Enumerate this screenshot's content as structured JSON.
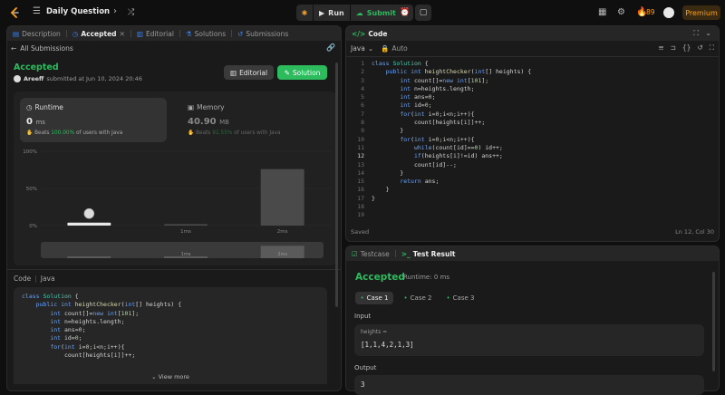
{
  "topbar": {
    "title": "Daily Question",
    "run_label": "Run",
    "submit_label": "Submit",
    "streak": "89",
    "premium_label": "Premium"
  },
  "left_tabs": {
    "description": "Description",
    "accepted": "Accepted",
    "editorial": "Editorial",
    "solutions": "Solutions",
    "submissions": "Submissions"
  },
  "submission": {
    "back_label": "All Submissions",
    "status": "Accepted",
    "author": "Areeff",
    "submitted_text": "submitted at Jun 10, 2024 20:46",
    "editorial_btn": "Editorial",
    "solution_btn": "Solution"
  },
  "runtime": {
    "label": "Runtime",
    "value": "0",
    "unit": "ms",
    "beats_prefix": "Beats",
    "beats_pct": "100.00%",
    "beats_suffix": "of users with Java"
  },
  "memory": {
    "label": "Memory",
    "value": "40.90",
    "unit": "MB",
    "beats_prefix": "Beats",
    "beats_pct": "91.55%",
    "beats_suffix": "of users with Java"
  },
  "chart_data": {
    "type": "bar",
    "ytick_labels": [
      "100%",
      "50%",
      "0%"
    ],
    "ylim": [
      0,
      100
    ],
    "categories": [
      "0ms",
      "1ms",
      "2ms"
    ],
    "values": [
      4,
      2,
      76
    ],
    "visible_x_labels": [
      "",
      "1ms",
      "2ms"
    ],
    "mini_labels": [
      "",
      "1ms",
      "2ms"
    ]
  },
  "lower_code": {
    "header": "Code",
    "lang": "Java",
    "view_more": "View more"
  },
  "editor": {
    "title": "Code",
    "lang": "Java",
    "auto": "Auto",
    "saved": "Saved",
    "cursor": "Ln 12, Col 30"
  },
  "testpanel": {
    "testcase_tab": "Testcase",
    "result_tab": "Test Result",
    "status": "Accepted",
    "runtime": "Runtime: 0 ms",
    "cases": [
      "Case 1",
      "Case 2",
      "Case 3"
    ],
    "input_label": "Input",
    "var_name": "heights =",
    "input_value": "[1,1,4,2,1,3]",
    "output_label": "Output",
    "output_value": "3"
  },
  "colors": {
    "accent_green": "#2cbb5d",
    "accent_orange": "#ffa116",
    "accent_blue": "#3b82f6"
  }
}
